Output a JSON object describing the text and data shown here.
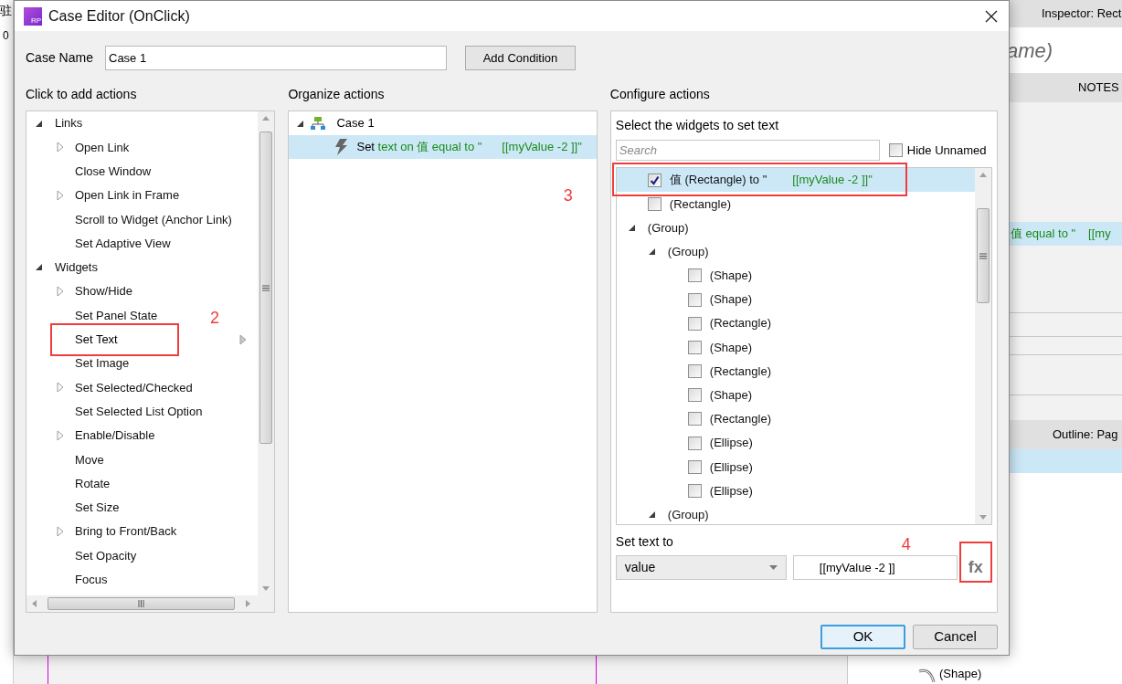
{
  "background": {
    "ruler_char": "驻",
    "ruler_value": "0",
    "inspector": {
      "title": "Inspector: Rect",
      "name": "ame)",
      "tab": "NOTES",
      "action_detail": "值 equal to \"",
      "action_value": "[[my",
      "outline_title": "Outline: Pag",
      "outline_item": "(Shape)"
    }
  },
  "dialog": {
    "icon_text": "RP",
    "title": "Case Editor (OnClick)",
    "case_name": {
      "label": "Case Name",
      "value": "Case 1"
    },
    "add_condition": "Add Condition",
    "add_actions": {
      "heading": "Click to add actions",
      "tree": [
        {
          "label": "Links",
          "expanded": true,
          "children": [
            {
              "label": "Open Link",
              "kind": "folder",
              "selected": false
            },
            {
              "label": "Close Window",
              "kind": "action",
              "selected": false
            },
            {
              "label": "Open Link in Frame",
              "kind": "folder",
              "selected": false
            },
            {
              "label": "Scroll to Widget (Anchor Link)",
              "kind": "action",
              "selected": false
            },
            {
              "label": "Set Adaptive View",
              "kind": "action",
              "selected": false
            }
          ]
        },
        {
          "label": "Widgets",
          "expanded": true,
          "children": [
            {
              "label": "Show/Hide",
              "kind": "folder",
              "selected": false
            },
            {
              "label": "Set Panel State",
              "kind": "action",
              "selected": false
            },
            {
              "label": "Set Text",
              "kind": "action",
              "selected": true,
              "note": "2"
            },
            {
              "label": "Set Image",
              "kind": "action",
              "selected": false
            },
            {
              "label": "Set Selected/Checked",
              "kind": "folder",
              "selected": false
            },
            {
              "label": "Set Selected List Option",
              "kind": "action",
              "selected": false
            },
            {
              "label": "Enable/Disable",
              "kind": "folder",
              "selected": false
            },
            {
              "label": "Move",
              "kind": "action",
              "selected": false
            },
            {
              "label": "Rotate",
              "kind": "action",
              "selected": false
            },
            {
              "label": "Set Size",
              "kind": "action",
              "selected": false
            },
            {
              "label": "Bring to Front/Back",
              "kind": "folder",
              "selected": false
            },
            {
              "label": "Set Opacity",
              "kind": "action",
              "selected": false
            },
            {
              "label": "Focus",
              "kind": "action",
              "selected": false
            }
          ]
        }
      ]
    },
    "organize": {
      "heading": "Organize actions",
      "case": {
        "label": "Case 1",
        "expanded": true,
        "action": {
          "verb": "Set",
          "detail": "text on 值 equal to \"",
          "value": "[[myValue -2 ]]\"",
          "selected": true
        }
      }
    },
    "configure": {
      "heading": "Configure actions",
      "prompt": "Select the widgets to set text",
      "search": {
        "placeholder": "Search"
      },
      "hide_unnamed": {
        "label": "Hide Unnamed",
        "checked": false
      },
      "widgets": [
        {
          "kind": "widget",
          "name": "值 (Rectangle) to \"",
          "value": "[[myValue -2 ]]\"",
          "checked": true,
          "selected": true,
          "note": "3"
        },
        {
          "kind": "widget",
          "name": "(Rectangle)",
          "checked": false,
          "selected": false
        },
        {
          "kind": "group",
          "name": "(Group)",
          "expanded": true,
          "children": [
            {
              "kind": "group",
              "name": "(Group)",
              "expanded": true,
              "children": [
                {
                  "kind": "widget",
                  "name": "(Shape)",
                  "checked": false,
                  "selected": false
                },
                {
                  "kind": "widget",
                  "name": "(Shape)",
                  "checked": false,
                  "selected": false
                },
                {
                  "kind": "widget",
                  "name": "(Rectangle)",
                  "checked": false,
                  "selected": false
                },
                {
                  "kind": "widget",
                  "name": "(Shape)",
                  "checked": false,
                  "selected": false
                },
                {
                  "kind": "widget",
                  "name": "(Rectangle)",
                  "checked": false,
                  "selected": false
                },
                {
                  "kind": "widget",
                  "name": "(Shape)",
                  "checked": false,
                  "selected": false
                },
                {
                  "kind": "widget",
                  "name": "(Rectangle)",
                  "checked": false,
                  "selected": false
                },
                {
                  "kind": "widget",
                  "name": "(Ellipse)",
                  "checked": false,
                  "selected": false
                },
                {
                  "kind": "widget",
                  "name": "(Ellipse)",
                  "checked": false,
                  "selected": false
                },
                {
                  "kind": "widget",
                  "name": "(Ellipse)",
                  "checked": false,
                  "selected": false
                }
              ]
            },
            {
              "kind": "group",
              "name": "(Group)",
              "expanded": true
            }
          ]
        }
      ],
      "set_text": {
        "label": "Set text to",
        "type": "value",
        "value": "[[myValue -2 ]]",
        "function_button": {
          "label": "fx",
          "note": "4"
        }
      }
    },
    "buttons": [
      {
        "label": "OK",
        "default": true
      },
      {
        "label": "Cancel",
        "default": false
      }
    ]
  }
}
